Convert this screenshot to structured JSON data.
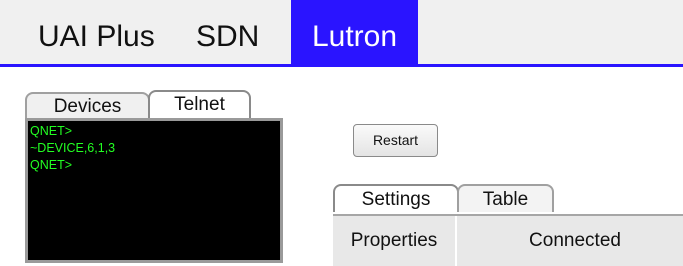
{
  "top_tabs": [
    {
      "label": "UAI Plus"
    },
    {
      "label": "SDN"
    },
    {
      "label": "Lutron",
      "active": true
    }
  ],
  "left_panel": {
    "tabs": [
      {
        "label": "Devices"
      },
      {
        "label": "Telnet",
        "selected": true
      }
    ],
    "terminal_lines": [
      "QNET>",
      "~DEVICE,6,1,3",
      "QNET>"
    ]
  },
  "restart_button": "Restart",
  "right_panel": {
    "tabs": [
      {
        "label": "Settings",
        "selected": true
      },
      {
        "label": "Table"
      }
    ],
    "properties_label": "Properties",
    "status_value": "Connected"
  },
  "colors": {
    "accent": "#2a14ff",
    "terminal_bg": "#000000",
    "terminal_text": "#22ff22"
  }
}
